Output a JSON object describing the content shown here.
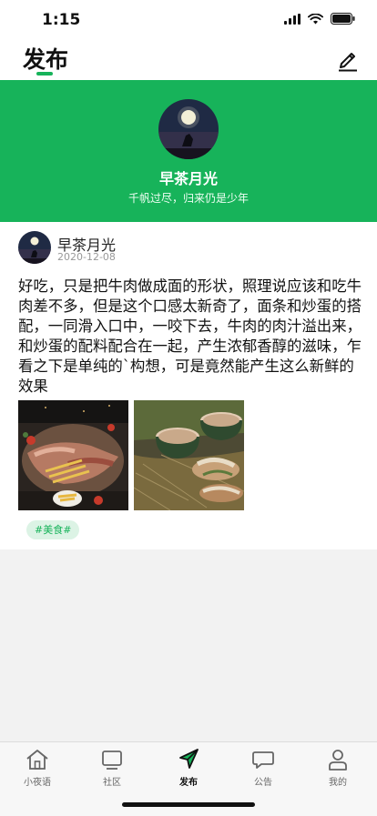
{
  "status_bar": {
    "time": "1:15"
  },
  "nav": {
    "title": "发布",
    "edit_icon": "edit-icon"
  },
  "profile": {
    "name": "早茶月光",
    "motto": "千帆过尽，归来仍是少年"
  },
  "post": {
    "author": "早茶月光",
    "date": "2020-12-08",
    "text": "好吃，只是把牛肉做成面的形状，照理说应该和吃牛肉差不多，但是这个口感太新奇了，面条和炒蛋的搭配，一同滑入口中，一咬下去，牛肉的肉汁溢出来，和炒蛋的配料配合在一起，产生浓郁香醇的滋味，乍看之下是单纯的`构想，可是竟然能产生这么新鲜的效果",
    "tag": "#美食#"
  },
  "tabs": [
    {
      "label": "小夜语",
      "icon": "home-icon"
    },
    {
      "label": "社区",
      "icon": "monitor-icon"
    },
    {
      "label": "发布",
      "icon": "send-icon"
    },
    {
      "label": "公告",
      "icon": "message-icon"
    },
    {
      "label": "我的",
      "icon": "user-icon"
    }
  ],
  "colors": {
    "accent": "#17b35a",
    "tag_bg": "#dcf3e5"
  }
}
